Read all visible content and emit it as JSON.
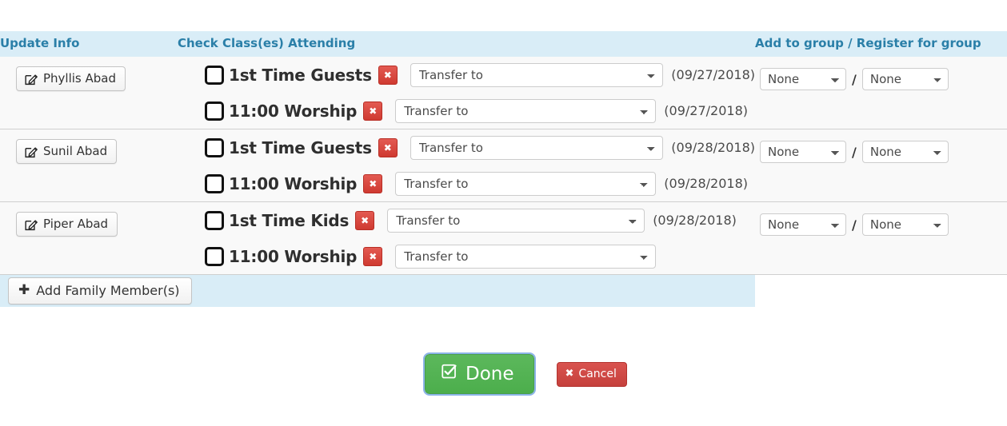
{
  "top_artifact": "",
  "header": {
    "col_update": "Update Info",
    "col_classes": "Check Class(es) Attending",
    "col_groups": "Add to group / Register for group"
  },
  "colors": {
    "header_band": "#d9edf7",
    "header_text": "#2a7fa8",
    "row_bg": "#f9f9f9",
    "remove_badge": "#cf3a31",
    "done_green": "#5cb85c",
    "cancel_red": "#d9534f",
    "focus_ring": "#8cb4e8"
  },
  "rows": [
    {
      "name": "Phyllis Abad",
      "edit_icon": "edit-pencil-icon",
      "classes": [
        {
          "label": "1st Time Guests",
          "checked": false,
          "remove_icon": "remove-x-icon",
          "transfer_value": "Transfer to",
          "date": "(09/27/2018)",
          "select_width": "wide"
        },
        {
          "label": "11:00 Worship",
          "checked": false,
          "remove_icon": "remove-x-icon",
          "transfer_value": "Transfer to",
          "date": "(09/27/2018)",
          "select_width": "narrow"
        }
      ],
      "group_add": "None",
      "group_separator": "/",
      "group_register": "None"
    },
    {
      "name": "Sunil Abad",
      "edit_icon": "edit-pencil-icon",
      "classes": [
        {
          "label": "1st Time Guests",
          "checked": false,
          "remove_icon": "remove-x-icon",
          "transfer_value": "Transfer to",
          "date": "(09/28/2018)",
          "select_width": "wide"
        },
        {
          "label": "11:00 Worship",
          "checked": false,
          "remove_icon": "remove-x-icon",
          "transfer_value": "Transfer to",
          "date": "(09/28/2018)",
          "select_width": "narrow"
        }
      ],
      "group_add": "None",
      "group_separator": "/",
      "group_register": "None"
    },
    {
      "name": "Piper Abad",
      "edit_icon": "edit-pencil-icon",
      "classes": [
        {
          "label": "1st Time Kids",
          "checked": false,
          "remove_icon": "remove-x-icon",
          "transfer_value": "Transfer to",
          "date": "(09/28/2018)",
          "select_width": "wide"
        },
        {
          "label": "11:00 Worship",
          "checked": false,
          "remove_icon": "remove-x-icon",
          "transfer_value": "Transfer to",
          "date": "",
          "select_width": "narrow"
        }
      ],
      "group_add": "None",
      "group_separator": "/",
      "group_register": "None"
    }
  ],
  "add_family": {
    "label": "Add Family Member(s)",
    "icon": "plus-icon"
  },
  "actions": {
    "done_label": "Done",
    "done_icon": "check-square-icon",
    "cancel_label": "Cancel",
    "cancel_icon": "x-icon"
  }
}
